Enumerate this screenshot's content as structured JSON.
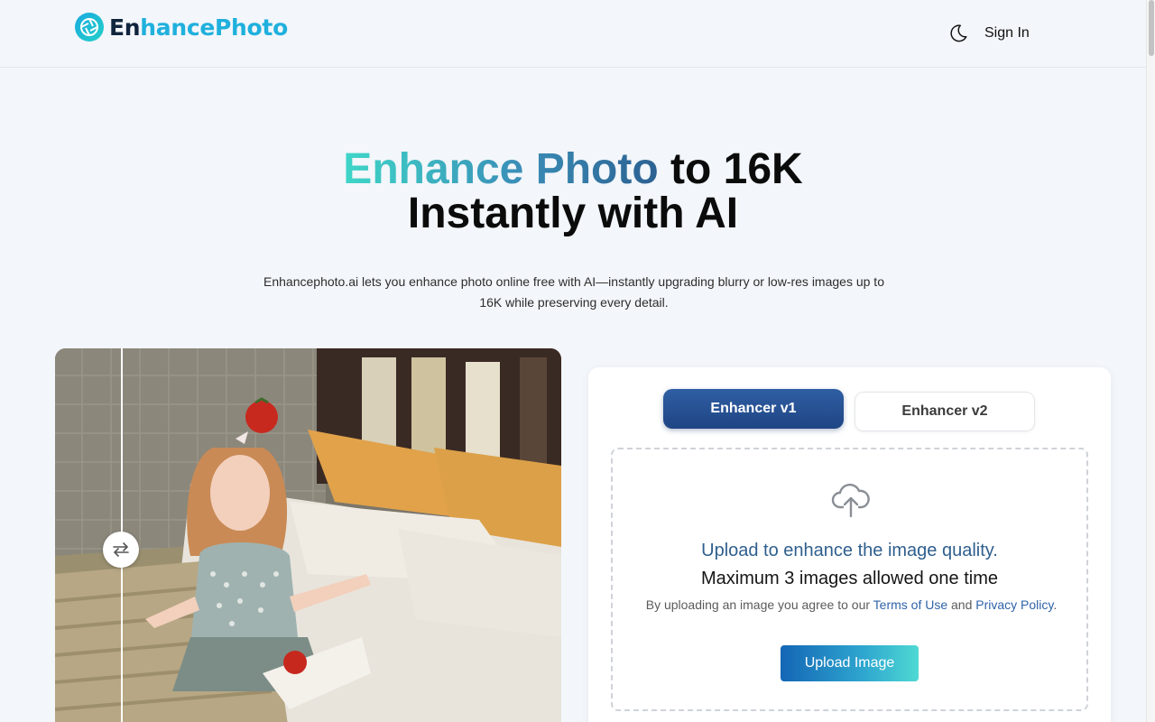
{
  "header": {
    "logo": {
      "text_dark": "En",
      "text_light": "hancePhoto",
      "icon": "camera-aperture-logo"
    },
    "theme_toggle_icon": "moon-icon",
    "signin_label": "Sign In"
  },
  "hero": {
    "title_gradient": "Enhance Photo",
    "title_rest": " to 16K",
    "title_line2": "Instantly with AI",
    "subtitle": "Enhancephoto.ai lets you enhance photo online free with AI—instantly upgrading blurry or low-res images up to 16K while preserving every detail."
  },
  "compare": {
    "handle_icon": "swap-arrows-icon"
  },
  "uploader": {
    "tabs": [
      {
        "label": "Enhancer v1",
        "active": true
      },
      {
        "label": "Enhancer v2",
        "active": false
      }
    ],
    "upload_icon": "cloud-upload-icon",
    "title": "Upload to enhance the image quality.",
    "max_note": "Maximum 3 images allowed one time",
    "agree_prefix": "By uploading an image you agree to our ",
    "terms_label": "Terms of Use",
    "agree_and": " and ",
    "privacy_label": "Privacy Policy",
    "agree_suffix": ".",
    "button_label": "Upload Image"
  },
  "colors": {
    "accent_dark": "#1f4584",
    "accent_teal": "#3fd6c8",
    "link": "#2f62a8",
    "background": "#f3f6fa"
  }
}
